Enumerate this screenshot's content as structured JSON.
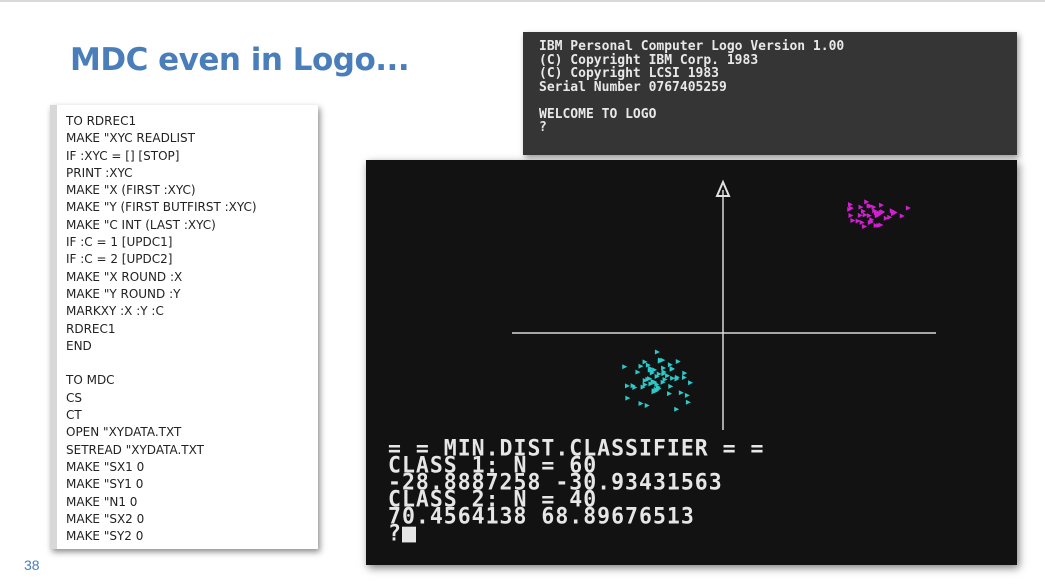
{
  "slide": {
    "title": "MDC even in Logo...",
    "page_number": "38"
  },
  "code_listing": [
    "TO RDREC1",
    "MAKE \"XYC READLIST",
    "IF :XYC = [] [STOP]",
    "PRINT :XYC",
    "MAKE \"X (FIRST :XYC)",
    "MAKE \"Y (FIRST BUTFIRST :XYC)",
    "MAKE \"C INT (LAST :XYC)",
    "IF :C = 1 [UPDC1]",
    "IF :C = 2 [UPDC2]",
    "MAKE \"X ROUND :X",
    "MAKE \"Y ROUND :Y",
    "MARKXY :X :Y :C",
    "RDREC1",
    "END",
    "",
    "TO MDC",
    "CS",
    "CT",
    "OPEN \"XYDATA.TXT",
    "SETREAD \"XYDATA.TXT",
    "MAKE \"SX1 0",
    "MAKE \"SY1 0",
    "MAKE \"N1 0",
    "MAKE \"SX2 0",
    "MAKE \"SY2 0"
  ],
  "logo_screen": [
    "IBM Personal Computer Logo Version 1.00",
    "(C) Copyright IBM Corp. 1983",
    "(C) Copyright LCSI 1983",
    "Serial Number 0767405259",
    "",
    "WELCOME TO LOGO",
    "?"
  ],
  "graphics_screen": {
    "output": [
      "= = MIN.DIST.CLASSIFIER = =",
      "CLASS 1: N = 60",
      "-28.8887258 -30.93431563",
      "CLASS 2: N = 40",
      "70.4564138 68.89676513"
    ],
    "prompt": "?",
    "colors": {
      "class1": "#2ec8c8",
      "class2": "#d21fd2",
      "axes": "#d8d8d8",
      "background": "#121212"
    }
  }
}
